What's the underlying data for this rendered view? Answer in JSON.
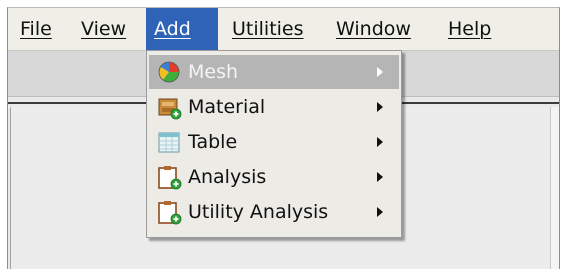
{
  "menubar": {
    "items": [
      {
        "label": "File",
        "active": false
      },
      {
        "label": "View",
        "active": false
      },
      {
        "label": "Add",
        "active": true
      },
      {
        "label": "Utilities",
        "active": false
      },
      {
        "label": "Window",
        "active": false
      },
      {
        "label": "Help",
        "active": false
      }
    ]
  },
  "add_menu": {
    "items": [
      {
        "label": "Mesh",
        "icon": "mesh-icon",
        "highlighted": true,
        "has_submenu": true
      },
      {
        "label": "Material",
        "icon": "material-icon",
        "highlighted": false,
        "has_submenu": true
      },
      {
        "label": "Table",
        "icon": "table-icon",
        "highlighted": false,
        "has_submenu": true
      },
      {
        "label": "Analysis",
        "icon": "analysis-icon",
        "highlighted": false,
        "has_submenu": true
      },
      {
        "label": "Utility Analysis",
        "icon": "utility-analysis-icon",
        "highlighted": false,
        "has_submenu": true
      }
    ]
  },
  "colors": {
    "menu_active_bg": "#2f63b8",
    "menu_highlight_bg": "#b5b5b5",
    "menubar_bg": "#efefe8",
    "dropdown_bg": "#ecebe6"
  }
}
